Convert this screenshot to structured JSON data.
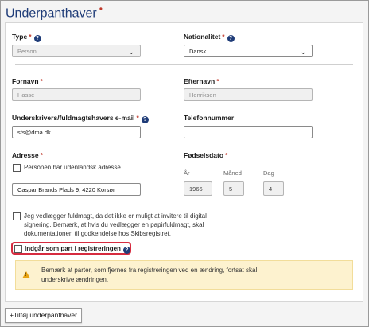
{
  "title": "Underpanthaver",
  "title_marker": "•",
  "required_mark": "*",
  "type": {
    "label": "Type",
    "value": "Person"
  },
  "nationality": {
    "label": "Nationalitet",
    "value": "Dansk"
  },
  "first_name": {
    "label": "Fornavn",
    "value": "Hasse"
  },
  "last_name": {
    "label": "Efternavn",
    "value": "Henriksen"
  },
  "email": {
    "label": "Underskrivers/fuldmagtshavers e-mail",
    "value": "sfs@dma.dk"
  },
  "phone": {
    "label": "Telefonnummer",
    "value": ""
  },
  "address": {
    "label": "Adresse",
    "foreign_label": "Personen har udenlandsk adresse",
    "value": "Caspar Brands Plads 9, 4220 Korsør"
  },
  "birthdate": {
    "label": "Fødselsdato",
    "year_label": "År",
    "year": "1966",
    "month_label": "Måned",
    "month": "5",
    "day_label": "Dag",
    "day": "4"
  },
  "power_of_attorney": {
    "line1": "Jeg vedlægger fuldmagt, da det ikke er muligt at invitere til digital",
    "line2": "signering. Bemærk, at hvis du vedlægger en papirfuldmagt, skal",
    "line3": "dokumentationen til godkendelse hos Skibsregistret."
  },
  "party_checkbox": {
    "label": "Indgår som part i registreringen"
  },
  "warning": {
    "line1": "Bemærk at parter, som fjernes fra registreringen ved en ændring, fortsat skal",
    "line2": "underskrive ændringen."
  },
  "add_button": "+Tilføj underpanthaver",
  "colors": {
    "accent": "#1f3c78",
    "required": "#c0392b",
    "highlight": "#d62b3f",
    "warning_bg": "#fdf2cf",
    "warning_icon": "#e8a313"
  }
}
